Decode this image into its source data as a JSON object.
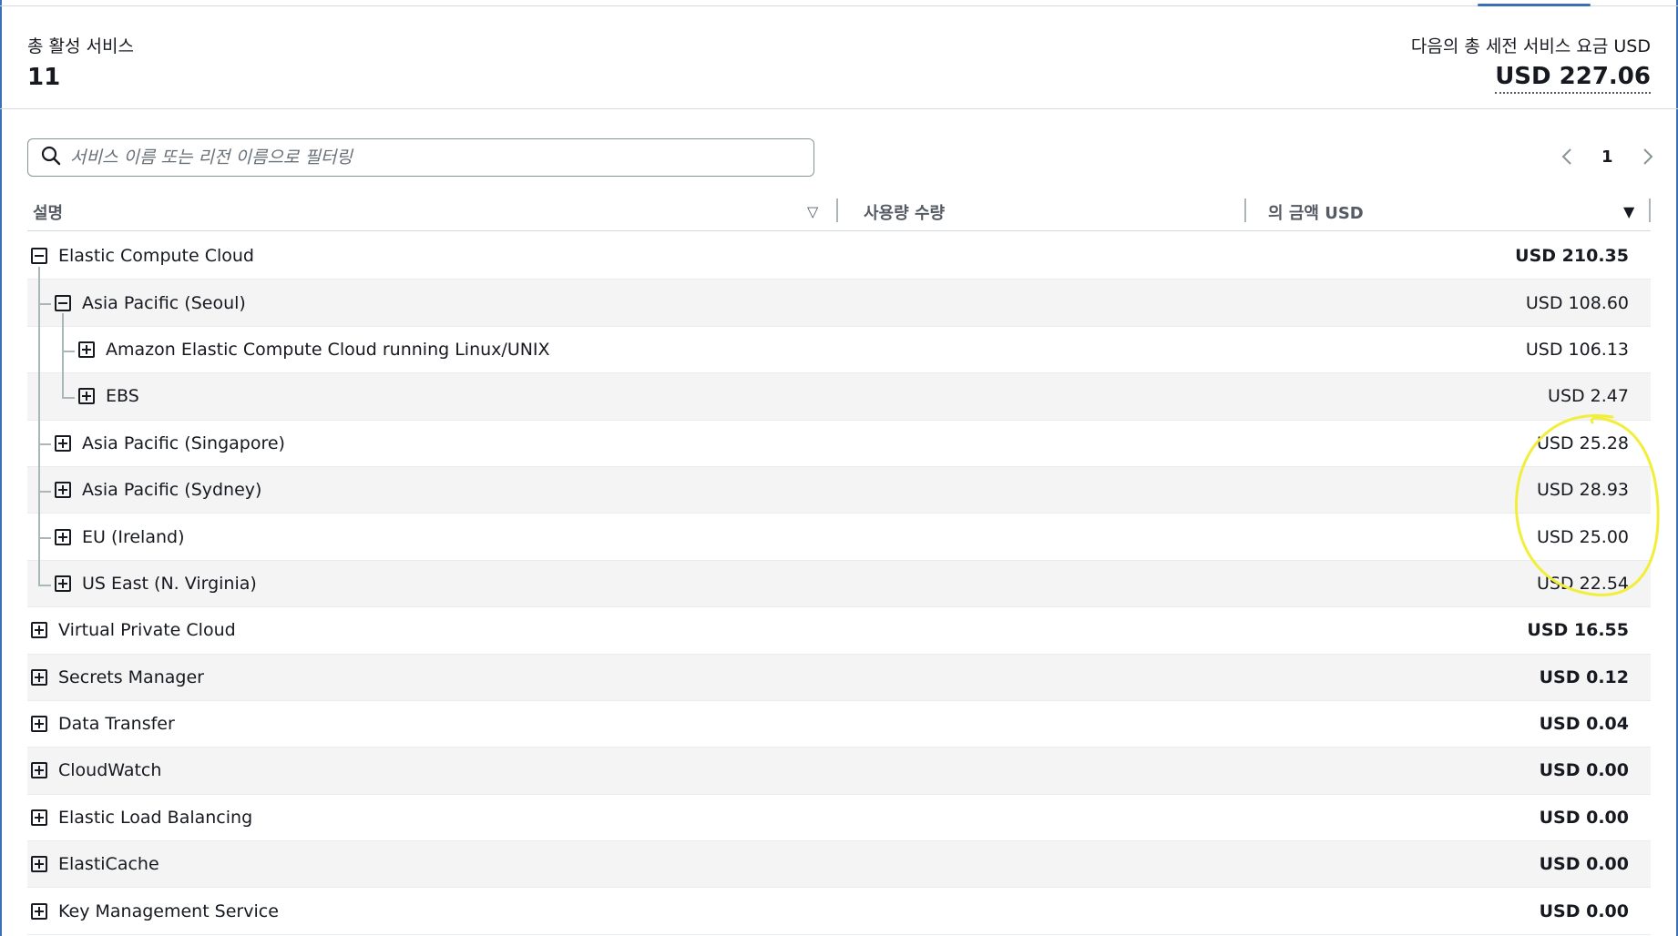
{
  "summary": {
    "active_services_label": "총 활성 서비스",
    "active_services_value": "11",
    "total_charge_label": "다음의 총 세전 서비스 요금 USD",
    "total_charge_value": "USD 227.06"
  },
  "search": {
    "placeholder": "서비스 이름 또는 리전 이름으로 필터링"
  },
  "pagination": {
    "current_page": "1",
    "prev_icon": "chevron-left-icon",
    "next_icon": "chevron-right-icon"
  },
  "table": {
    "columns": {
      "description": "설명",
      "usage": "사용량 수량",
      "amount": "의 금액 USD"
    },
    "rows": [
      {
        "label": "Elastic Compute Cloud",
        "amount": "USD 210.35",
        "level": 0,
        "expanded": true,
        "bold": true
      },
      {
        "label": "Asia Pacific (Seoul)",
        "amount": "USD 108.60",
        "level": 1,
        "expanded": true,
        "bold": false
      },
      {
        "label": "Amazon Elastic Compute Cloud running Linux/UNIX",
        "amount": "USD 106.13",
        "level": 2,
        "expanded": false,
        "bold": false
      },
      {
        "label": "EBS",
        "amount": "USD 2.47",
        "level": 2,
        "expanded": false,
        "bold": false
      },
      {
        "label": "Asia Pacific (Singapore)",
        "amount": "USD 25.28",
        "level": 1,
        "expanded": false,
        "bold": false
      },
      {
        "label": "Asia Pacific (Sydney)",
        "amount": "USD 28.93",
        "level": 1,
        "expanded": false,
        "bold": false
      },
      {
        "label": "EU (Ireland)",
        "amount": "USD 25.00",
        "level": 1,
        "expanded": false,
        "bold": false
      },
      {
        "label": "US East (N. Virginia)",
        "amount": "USD 22.54",
        "level": 1,
        "expanded": false,
        "bold": false
      },
      {
        "label": "Virtual Private Cloud",
        "amount": "USD 16.55",
        "level": 0,
        "expanded": false,
        "bold": true
      },
      {
        "label": "Secrets Manager",
        "amount": "USD 0.12",
        "level": 0,
        "expanded": false,
        "bold": true
      },
      {
        "label": "Data Transfer",
        "amount": "USD 0.04",
        "level": 0,
        "expanded": false,
        "bold": true
      },
      {
        "label": "CloudWatch",
        "amount": "USD 0.00",
        "level": 0,
        "expanded": false,
        "bold": true
      },
      {
        "label": "Elastic Load Balancing",
        "amount": "USD 0.00",
        "level": 0,
        "expanded": false,
        "bold": true
      },
      {
        "label": "ElastiCache",
        "amount": "USD 0.00",
        "level": 0,
        "expanded": false,
        "bold": true
      },
      {
        "label": "Key Management Service",
        "amount": "USD 0.00",
        "level": 0,
        "expanded": false,
        "bold": true
      }
    ]
  },
  "colors": {
    "accent": "#3b6fb6",
    "highlight_annotation": "#f2ee3a"
  }
}
